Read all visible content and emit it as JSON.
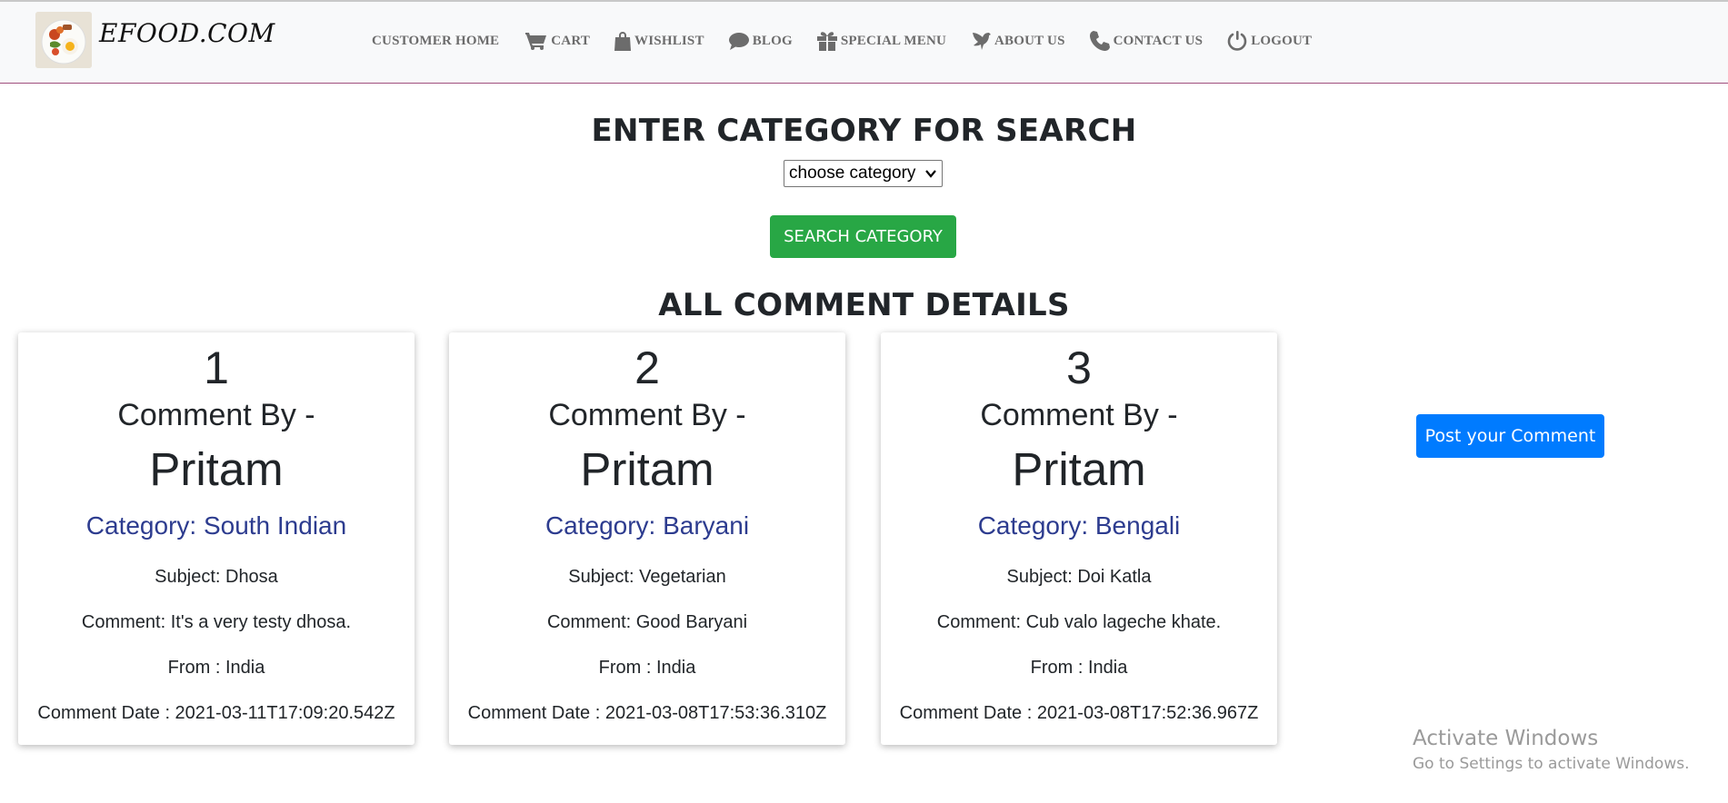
{
  "brand": {
    "name": "EFOOD.COM"
  },
  "nav": {
    "items": [
      {
        "label": "CUSTOMER HOME",
        "icon": "none"
      },
      {
        "label": "CART",
        "icon": "cart-icon"
      },
      {
        "label": "WISHLIST",
        "icon": "bag-icon"
      },
      {
        "label": "BLOG",
        "icon": "comment-icon"
      },
      {
        "label": "SPECIAL MENU",
        "icon": "gift-icon"
      },
      {
        "label": "ABOUT US",
        "icon": "dove-icon"
      },
      {
        "label": "CONTACT US",
        "icon": "phone-icon"
      },
      {
        "label": "LOGOUT",
        "icon": "power-icon"
      }
    ]
  },
  "search": {
    "heading": "ENTER CATEGORY FOR SEARCH",
    "select_value": "choose category",
    "button_label": "SEARCH CATEGORY"
  },
  "comments": {
    "heading": "ALL COMMENT DETAILS",
    "items": [
      {
        "number": "1",
        "by_label": "Comment By -",
        "name": "Pritam",
        "category": "Category: South Indian",
        "subject": "Subject: Dhosa",
        "comment": "Comment: It's a very testy dhosa.",
        "from": "From : India",
        "date": "Comment Date : 2021-03-11T17:09:20.542Z"
      },
      {
        "number": "2",
        "by_label": "Comment By -",
        "name": "Pritam",
        "category": "Category: Baryani",
        "subject": "Subject: Vegetarian",
        "comment": "Comment: Good Baryani",
        "from": "From : India",
        "date": "Comment Date : 2021-03-08T17:53:36.310Z"
      },
      {
        "number": "3",
        "by_label": "Comment By -",
        "name": "Pritam",
        "category": "Category: Bengali",
        "subject": "Subject: Doi Katla",
        "comment": "Comment: Cub valo lageche khate.",
        "from": "From : India",
        "date": "Comment Date : 2021-03-08T17:52:36.967Z"
      }
    ],
    "post_button": "Post your Comment"
  },
  "watermark": {
    "title": "Activate Windows",
    "subtitle": "Go to Settings to activate Windows."
  },
  "colors": {
    "nav_bg": "#f8f9fa",
    "nav_border": "#a04f7e",
    "search_btn": "#28a745",
    "post_btn": "#007bff",
    "category_text": "#2d3c8f"
  }
}
